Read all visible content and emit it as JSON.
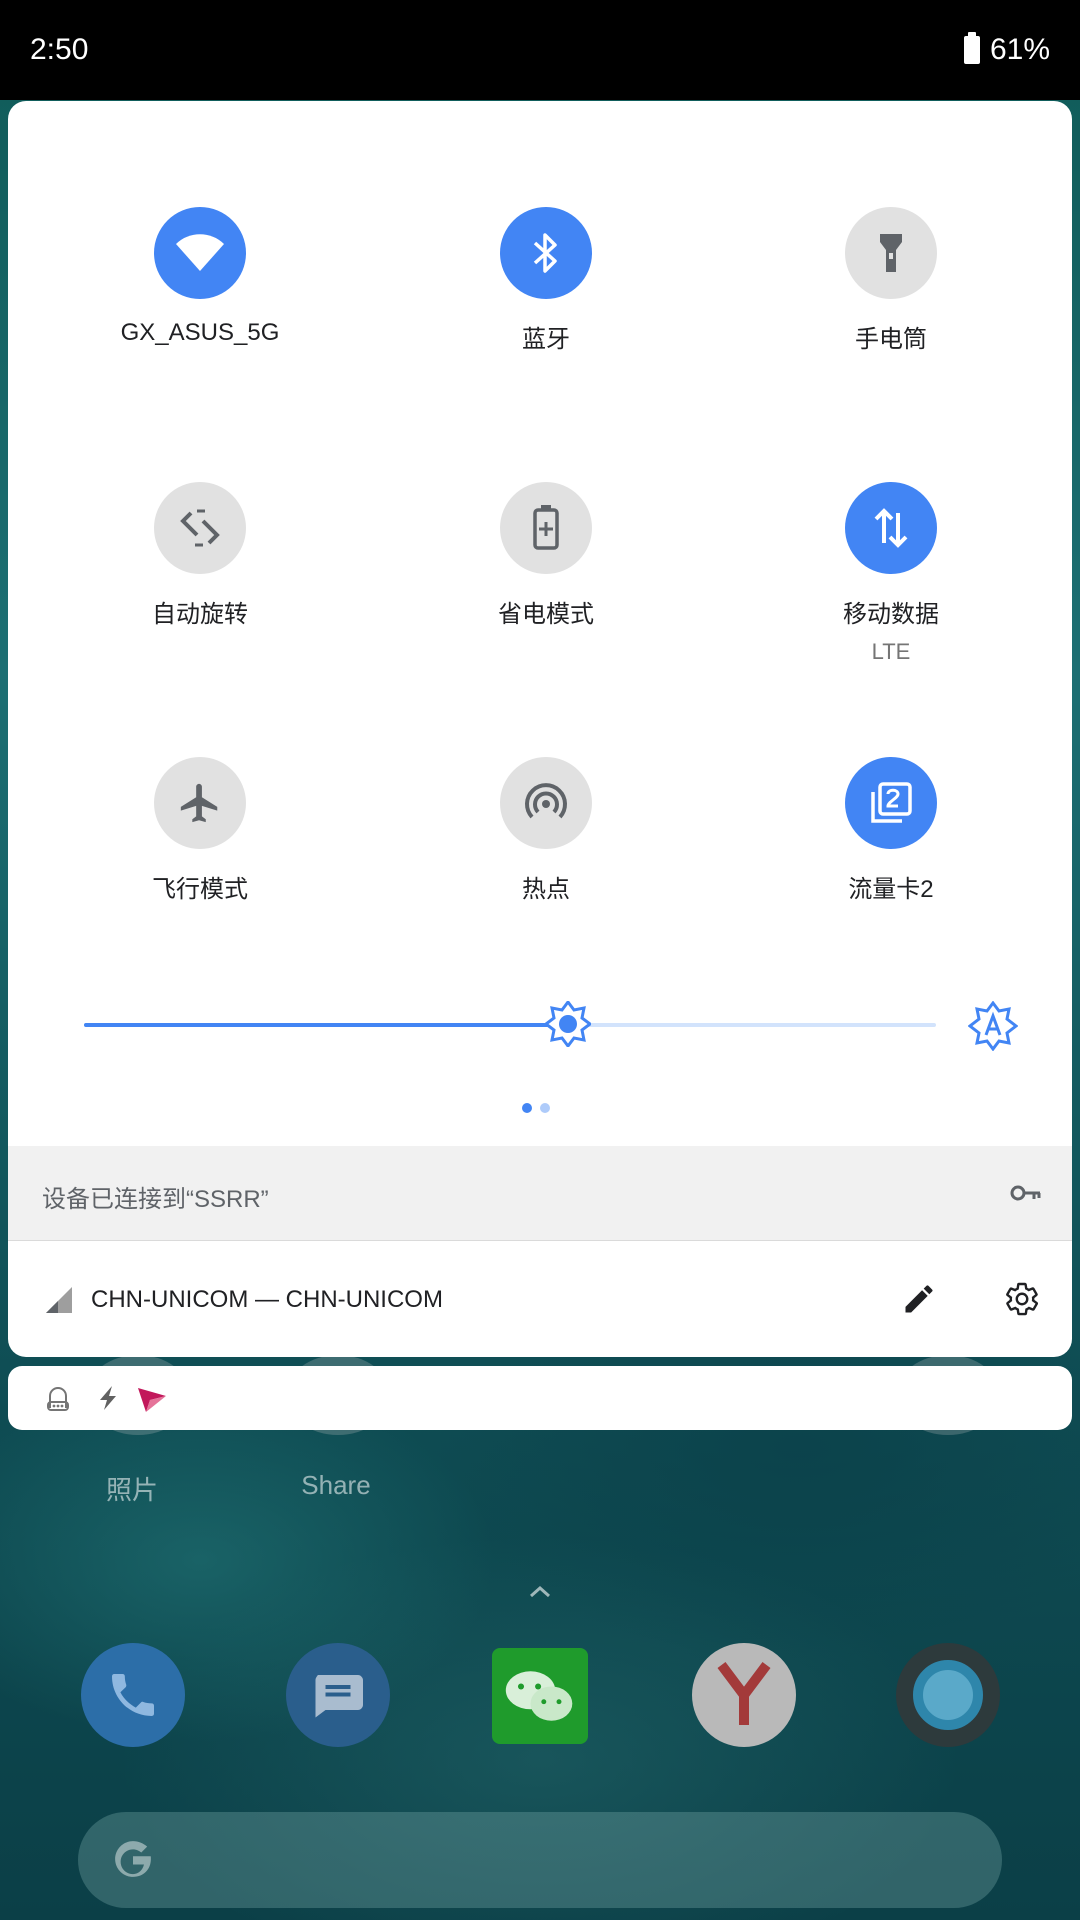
{
  "status_bar": {
    "time": "2:50",
    "battery": "61%"
  },
  "tiles": [
    {
      "label": "GX_ASUS_5G",
      "sublabel": "",
      "state": "on",
      "icon": "wifi-icon"
    },
    {
      "label": "蓝牙",
      "sublabel": "",
      "state": "on",
      "icon": "bluetooth-icon"
    },
    {
      "label": "手电筒",
      "sublabel": "",
      "state": "off",
      "icon": "flashlight-icon"
    },
    {
      "label": "自动旋转",
      "sublabel": "",
      "state": "off",
      "icon": "auto-rotate-icon"
    },
    {
      "label": "省电模式",
      "sublabel": "",
      "state": "off",
      "icon": "battery-saver-icon"
    },
    {
      "label": "移动数据",
      "sublabel": "LTE",
      "state": "on",
      "icon": "mobile-data-icon"
    },
    {
      "label": "飞行模式",
      "sublabel": "",
      "state": "off",
      "icon": "airplane-icon"
    },
    {
      "label": "热点",
      "sublabel": "",
      "state": "off",
      "icon": "hotspot-icon"
    },
    {
      "label": "流量卡2",
      "sublabel": "",
      "state": "on",
      "icon": "sim-card-2-icon"
    }
  ],
  "brightness": {
    "level": 0.568,
    "auto_icon": "auto-brightness-icon"
  },
  "pages": {
    "count": 2,
    "current": 1
  },
  "vpn": {
    "text": "设备已连接到“SSRR”",
    "icon": "vpn-key-icon"
  },
  "carrier": {
    "text": "CHN-UNICOM — CHN-UNICOM",
    "signal_icon": "signal-icon",
    "edit_icon": "edit-pencil-icon",
    "settings_icon": "settings-gear-icon"
  },
  "notification_icons": [
    "robot-notification-icon",
    "flash-notification-icon",
    "paper-plane-notification-icon"
  ],
  "home": {
    "labels": [
      "照片",
      "Share"
    ]
  },
  "dock": {
    "apps": [
      "phone-icon",
      "messages-icon",
      "wechat-icon",
      "yandex-icon",
      "browser-ring-icon"
    ]
  },
  "colors": {
    "accent": "#4285f4",
    "tile_off": "#e1e1e1",
    "wechat_green": "#1aad19",
    "yandex_red": "#e53935"
  }
}
